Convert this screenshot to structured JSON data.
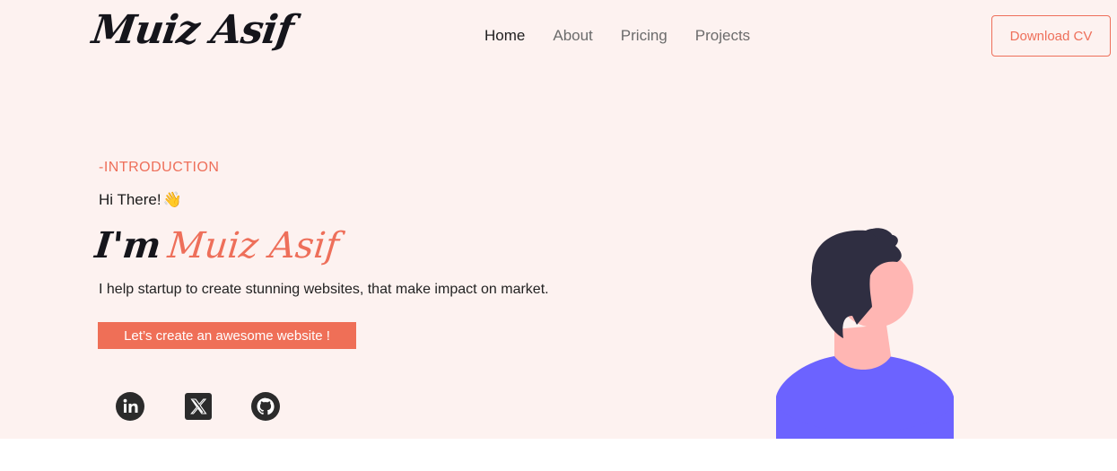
{
  "header": {
    "logo": "Muiz Asif",
    "nav": [
      {
        "label": "Home",
        "active": true
      },
      {
        "label": "About",
        "active": false
      },
      {
        "label": "Pricing",
        "active": false
      },
      {
        "label": "Projects",
        "active": false
      }
    ],
    "download_label": "Download CV"
  },
  "hero": {
    "intro": "-INTRODUCTION",
    "greeting": "Hi There!",
    "greeting_emoji": "👋",
    "headline_prefix": "I'm",
    "headline_name": "Muiz Asif",
    "tagline": "I help startup to create stunning websites, that make impact on market.",
    "cta_label": "Let’s create an awesome website !"
  },
  "social": [
    {
      "icon": "linkedin-icon"
    },
    {
      "icon": "x-twitter-icon"
    },
    {
      "icon": "github-icon"
    }
  ],
  "colors": {
    "background": "#fdf2f0",
    "accent": "#ee6f5a",
    "text_dark": "#15151b",
    "avatar_shirt": "#6c63ff",
    "avatar_skin": "#ffb6b3",
    "avatar_hair": "#2f2e41"
  }
}
